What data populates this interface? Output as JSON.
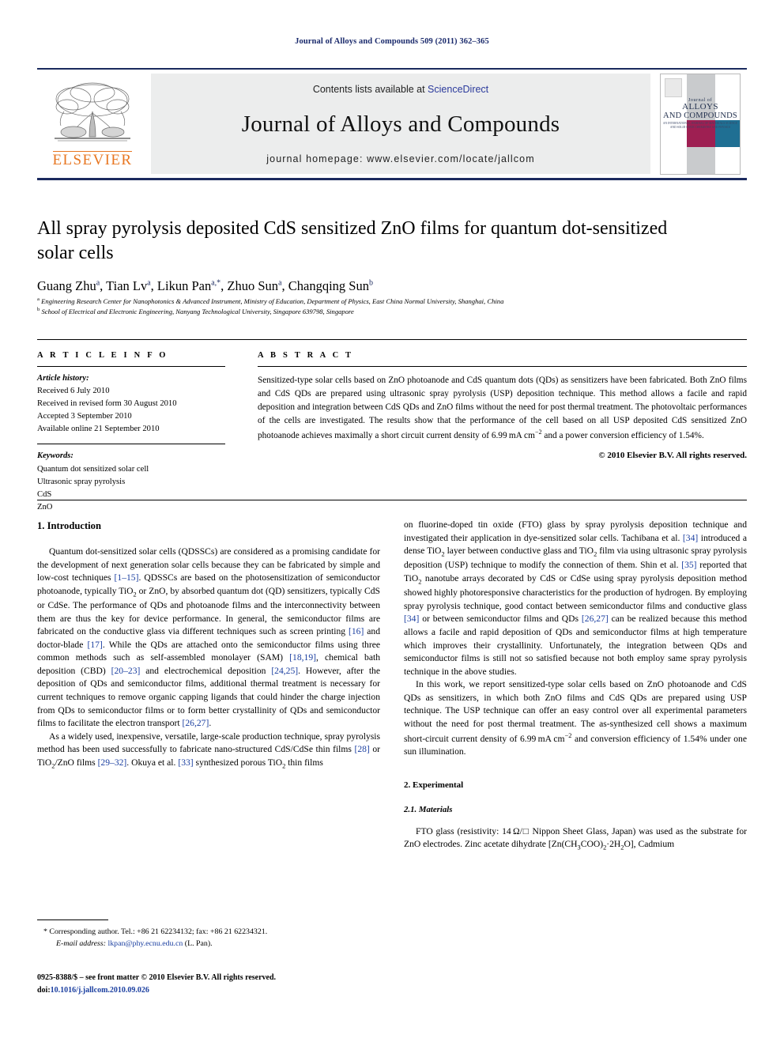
{
  "running_head": "Journal of Alloys and Compounds 509 (2011) 362–365",
  "masthead": {
    "contents_prefix": "Contents lists available at ",
    "sciencedirect": "ScienceDirect",
    "journal_title": "Journal of Alloys and Compounds",
    "homepage": "journal homepage: www.elsevier.com/locate/jallcom",
    "publisher": "ELSEVIER",
    "cover": {
      "line1": "Journal of",
      "line2": "ALLOYS",
      "line3": "AND COMPOUNDS",
      "line4": "AN INTERNATIONAL JOURNAL OF MATERIALS SCIENCE AND SOLID STATE CHEMISTRY AND PHYSICS"
    },
    "colors": {
      "rule": "#1b2a5e",
      "link": "#2b3a9c",
      "elsevier_orange": "#E87722",
      "cover_maroon": "#9e1f52",
      "cover_teal": "#1f6f93"
    }
  },
  "article": {
    "title": "All spray pyrolysis deposited CdS sensitized ZnO films for quantum dot-sensitized solar cells",
    "authors_html": "Guang Zhu<sup>a</sup>, Tian Lv<sup>a</sup>, Likun Pan<sup>a,*</sup>, Zhuo Sun<sup>a</sup>, Changqing Sun<sup>b</sup>",
    "affiliation_a": "Engineering Research Center for Nanophotonics & Advanced Instrument, Ministry of Education, Department of Physics, East China Normal University, Shanghai, China",
    "affiliation_b": "School of Electrical and Electronic Engineering, Nanyang Technological University, Singapore 639798, Singapore"
  },
  "info": {
    "heading": "A R T I C L E   I N F O",
    "history_label": "Article history:",
    "history": [
      "Received 6 July 2010",
      "Received in revised form 30 August 2010",
      "Accepted 3 September 2010",
      "Available online 21 September 2010"
    ],
    "keywords_label": "Keywords:",
    "keywords": [
      "Quantum dot sensitized solar cell",
      "Ultrasonic spray pyrolysis",
      "CdS",
      "ZnO"
    ]
  },
  "abstract": {
    "heading": "A B S T R A C T",
    "text_html": "Sensitized-type solar cells based on ZnO photoanode and CdS quantum dots (QDs) as sensitizers have been fabricated. Both ZnO films and CdS QDs are prepared using ultrasonic spray pyrolysis (USP) deposition technique. This method allows a facile and rapid deposition and integration between CdS QDs and ZnO films without the need for post thermal treatment. The photovoltaic performances of the cells are investigated. The results show that the performance of the cell based on all USP deposited CdS sensitized ZnO photoanode achieves maximally a short circuit current density of 6.99&thinsp;mA&thinsp;cm<sup>&minus;2</sup> and a power conversion efficiency of 1.54%.",
    "copyright": "© 2010 Elsevier B.V. All rights reserved."
  },
  "body": {
    "section1_heading": "1.  Introduction",
    "left_p1_html": "Quantum dot-sensitized solar cells (QDSSCs) are considered as a promising candidate for the development of next generation solar cells because they can be fabricated by simple and low-cost techniques <span class=\"ref\">[1–15]</span>. QDSSCs are based on the photosensitization of semiconductor photoanode, typically TiO<sub>2</sub> or ZnO, by absorbed quantum dot (QD) sensitizers, typically CdS or CdSe. The performance of QDs and photoanode films and the interconnectivity between them are thus the key for device performance. In general, the semiconductor films are fabricated on the conductive glass via different techniques such as screen printing <span class=\"ref\">[16]</span> and doctor-blade <span class=\"ref\">[17]</span>. While the QDs are attached onto the semiconductor films using three common methods such as self-assembled monolayer (SAM) <span class=\"ref\">[18,19]</span>, chemical bath deposition (CBD) <span class=\"ref\">[20–23]</span> and electrochemical deposition <span class=\"ref\">[24,25]</span>. However, after the deposition of QDs and semiconductor films, additional thermal treatment is necessary for current techniques to remove organic capping ligands that could hinder the charge injection from QDs to semiconductor films or to form better crystallinity of QDs and semiconductor films to facilitate the electron transport <span class=\"ref\">[26,27]</span>.",
    "left_p2_html": "As a widely used, inexpensive, versatile, large-scale production technique, spray pyrolysis method has been used successfully to fabricate nano-structured CdS/CdSe thin films <span class=\"ref\">[28]</span> or TiO<sub>2</sub>/ZnO films <span class=\"ref\">[29–32]</span>. Okuya et al. <span class=\"ref\">[33]</span> synthesized porous TiO<sub>2</sub> thin films",
    "right_p1_html": "on fluorine-doped tin oxide (FTO) glass by spray pyrolysis deposition technique and investigated their application in dye-sensitized solar cells. Tachibana et al. <span class=\"ref\">[34]</span> introduced a dense TiO<sub>2</sub> layer between conductive glass and TiO<sub>2</sub> film via using ultrasonic spray pyrolysis deposition (USP) technique to modify the connection of them. Shin et al. <span class=\"ref\">[35]</span> reported that TiO<sub>2</sub> nanotube arrays decorated by CdS or CdSe using spray pyrolysis deposition method showed highly photoresponsive characteristics for the production of hydrogen. By employing spray pyrolysis technique, good contact between semiconductor films and conductive glass <span class=\"ref\">[34]</span> or between semiconductor films and QDs <span class=\"ref\">[26,27]</span> can be realized because this method allows a facile and rapid deposition of QDs and semiconductor films at high temperature which improves their crystallinity. Unfortunately, the integration between QDs and semiconductor films is still not so satisfied because not both employ same spray pyrolysis technique in the above studies.",
    "right_p2_html": "In this work, we report sensitized-type solar cells based on ZnO photoanode and CdS QDs as sensitizers, in which both ZnO films and CdS QDs are prepared using USP technique. The USP technique can offer an easy control over all experimental parameters without the need for post thermal treatment. The as-synthesized cell shows a maximum short-circuit current density of 6.99&thinsp;mA&thinsp;cm<sup>&minus;2</sup> and conversion efficiency of 1.54% under one sun illumination.",
    "section2_heading": "2.  Experimental",
    "section21_heading": "2.1.  Materials",
    "right_p3_html": "FTO glass (resistivity: 14&thinsp;Ω/□ Nippon Sheet Glass, Japan) was used as the substrate for ZnO electrodes. Zinc acetate dihydrate [Zn(CH<sub>3</sub>COO)<sub>2</sub>·2H<sub>2</sub>O], Cadmium"
  },
  "footer": {
    "corresponding_html": "* Corresponding author. Tel.: +86 21 62234132; fax: +86 21 62234321.",
    "email_html": "<em>E-mail address:</em> <span class=\"mail\">lkpan@phy.ecnu.edu.cn</span> (L. Pan).",
    "imprint": "0925-8388/$ – see front matter © 2010 Elsevier B.V. All rights reserved.",
    "doi_prefix": "doi:",
    "doi": "10.1016/j.jallcom.2010.09.026"
  }
}
